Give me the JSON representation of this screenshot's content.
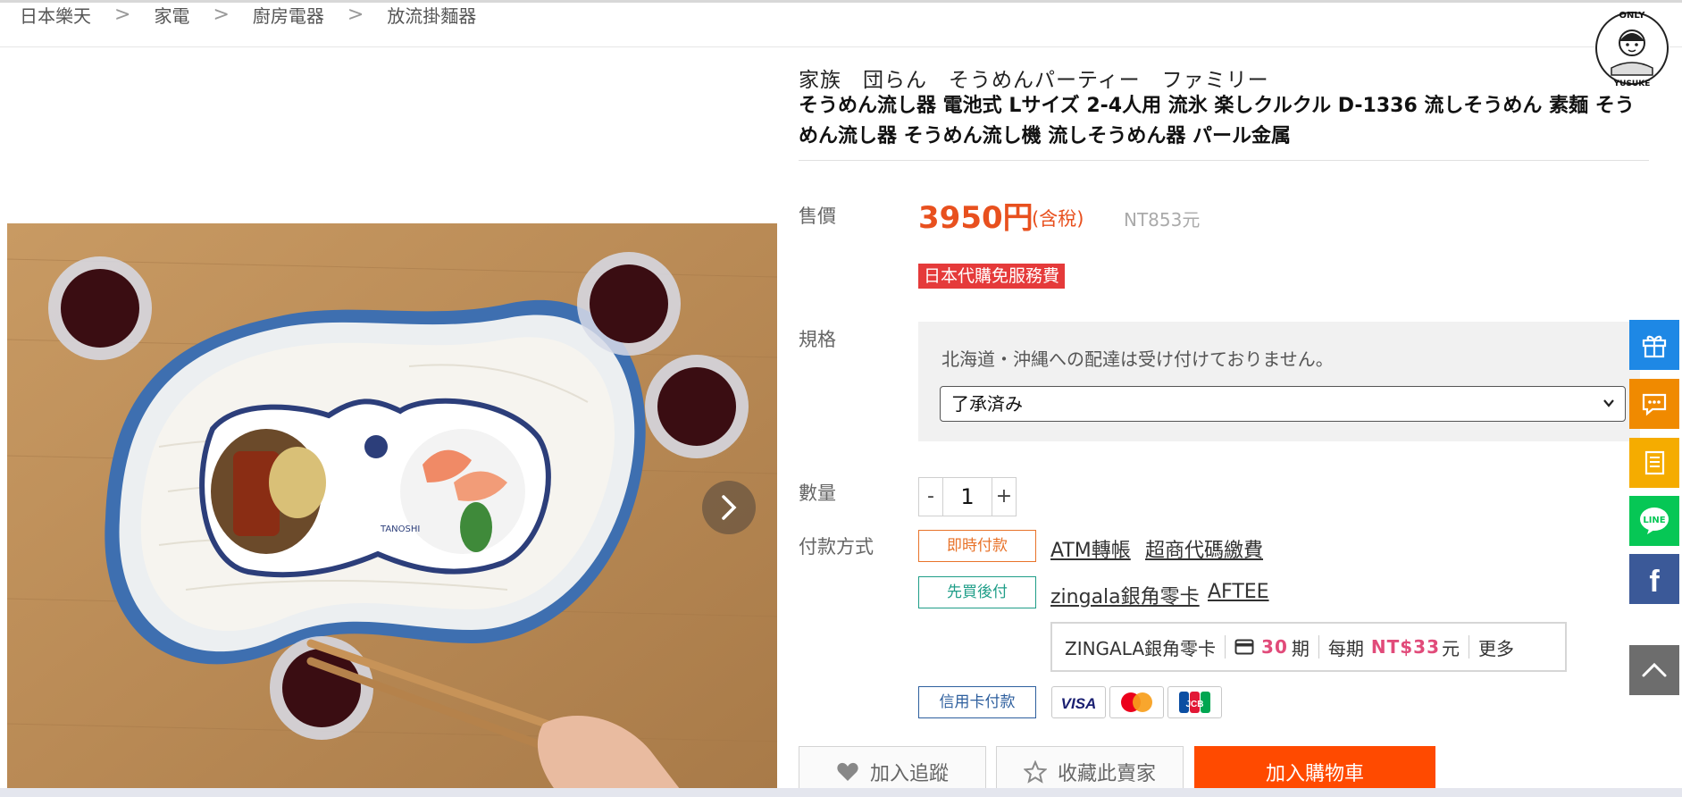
{
  "breadcrumb": [
    "日本樂天",
    "家電",
    "廚房電器",
    "放流掛麵器"
  ],
  "breadcrumb_separator": ">",
  "logo": {
    "top_text": "ONLY",
    "bottom_text": "YUSUKE"
  },
  "product": {
    "subtitle": "家族　団らん　そうめんパーティー　ファミリー",
    "title": "そうめん流し器 電池式 Lサイズ 2-4人用 流氷 楽しクルクル D-1336 流しそうめん 素麺 そうめん流し器 そうめん流し機 流しそうめん器 パール金属",
    "image_text": "TANOSHI"
  },
  "price": {
    "label": "售價",
    "amount": "3950円",
    "tax_note": "(含稅)",
    "twd": "NT853元",
    "badge": "日本代購免服務費"
  },
  "spec": {
    "label": "規格",
    "note": "北海道・沖縄への配達は受け付けておりません。",
    "selected": "了承済み"
  },
  "quantity": {
    "label": "數量",
    "minus": "-",
    "value": "1",
    "plus": "+"
  },
  "payment": {
    "label": "付款方式",
    "instant_tag": "即時付款",
    "atm": "ATM轉帳",
    "store": "超商代碼繳費",
    "bnpl_tag": "先買後付",
    "zingala_link": "zingala銀角零卡",
    "aftee": "AFTEE",
    "zingala_box": {
      "name": "ZINGALA銀角零卡",
      "installments": "30",
      "installments_unit": "期",
      "per_period_label": "每期",
      "per_period_amount": "NT$33",
      "per_period_unit": "元",
      "more": "更多"
    },
    "card_tag": "信用卡付款",
    "cards": [
      "VISA",
      "Mastercard",
      "JCB"
    ],
    "card_text": {
      "visa": "VISA",
      "jcb": "JCB"
    }
  },
  "actions": {
    "track": "加入追蹤",
    "favorite_seller": "收藏此賣家",
    "add_to_cart": "加入購物車"
  },
  "sidebar": [
    "gift-icon",
    "chat-icon",
    "notebook-icon",
    "line-icon",
    "facebook-icon",
    "back-to-top-icon"
  ],
  "sidebar_text": {
    "line": "LINE",
    "facebook": "f"
  },
  "colors": {
    "accent": "#e8501e",
    "cart": "#ff4a00",
    "badge": "#e53a3a",
    "side_blue": "#1e88e5",
    "side_orange": "#f08a00",
    "side_green": "#06c755",
    "side_fb": "#3b5998"
  }
}
